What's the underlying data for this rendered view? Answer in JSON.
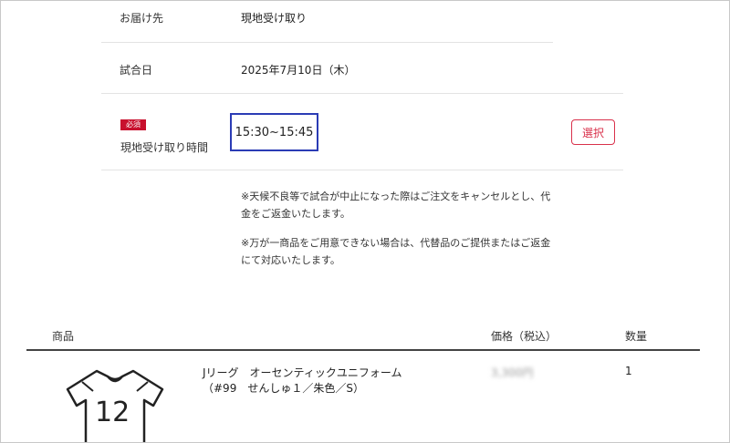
{
  "delivery": {
    "label": "お届け先",
    "value": "現地受け取り"
  },
  "match_date": {
    "label": "試合日",
    "value": "2025年7月10日（木）"
  },
  "pickup_time": {
    "required_badge": "必須",
    "label": "現地受け取り時間",
    "value": "15:30~15:45",
    "select_label": "選択"
  },
  "notes": [
    "※天候不良等で試合が中止になった際はご注文をキャンセルとし、代金をご返金いたします。",
    "※万が一商品をご用意できない場合は、代替品のご提供またはご返金にて対応いたします。"
  ],
  "product_table": {
    "headers": {
      "product": "商品",
      "price": "価格（税込）",
      "quantity": "数量"
    },
    "rows": [
      {
        "name_line1": "Jリーグ　オーセンティックユニフォーム",
        "name_line2": "（#99　せんしゅ１／朱色／S）",
        "price": "3,300円",
        "quantity": "1",
        "jersey_number": "12"
      }
    ]
  },
  "colors": {
    "accent": "#c8102e",
    "highlight_border": "#2b3cb5",
    "select_button": "#d9314b"
  }
}
